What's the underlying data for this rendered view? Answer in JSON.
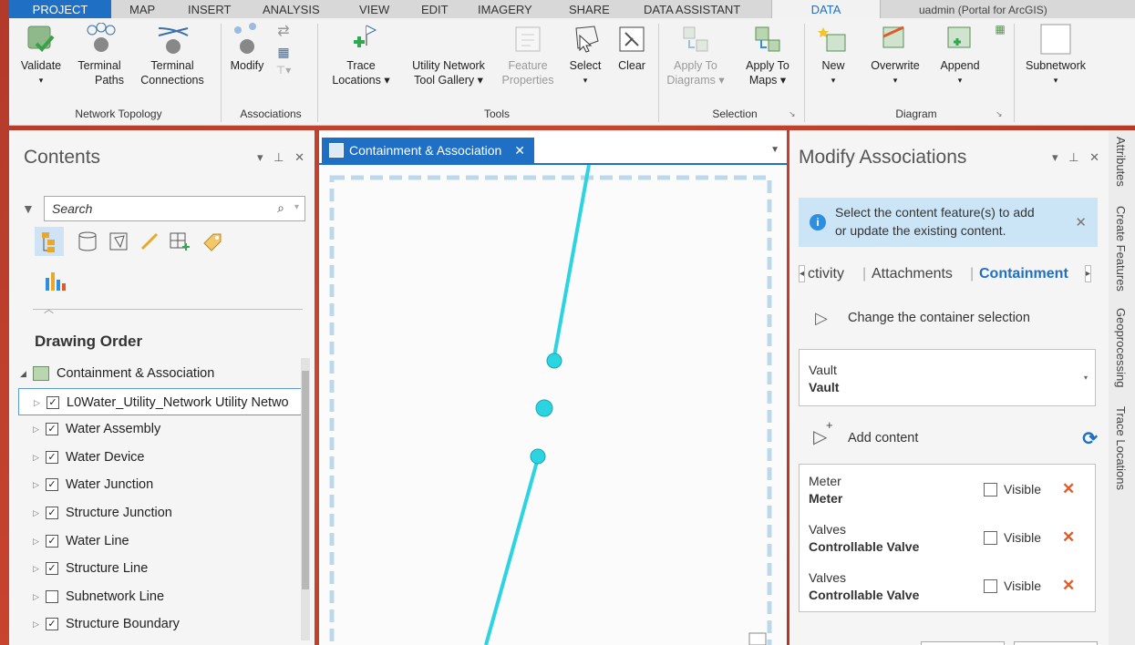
{
  "ribbon": {
    "tabs": [
      "PROJECT",
      "MAP",
      "INSERT",
      "ANALYSIS",
      "VIEW",
      "EDIT",
      "IMAGERY",
      "SHARE",
      "DATA ASSISTANT",
      "DATA",
      "uadmin (Portal for ArcGIS)"
    ],
    "groups": {
      "network_topology": "Network Topology",
      "associations": "Associations",
      "tools": "Tools",
      "selection": "Selection",
      "diagram": "Diagram"
    },
    "buttons": {
      "validate": "Validate",
      "terminal_paths_1": "Terminal",
      "terminal_paths_2": "Paths",
      "terminal_conn_1": "Terminal",
      "terminal_conn_2": "Connections",
      "modify": "Modify",
      "trace_1": "Trace",
      "trace_2": "Locations ▾",
      "gallery_1": "Utility Network",
      "gallery_2": "Tool Gallery ▾",
      "feature_1": "Feature",
      "feature_2": "Properties",
      "select": "Select",
      "clear": "Clear",
      "apply_diagrams_1": "Apply To",
      "apply_diagrams_2": "Diagrams ▾",
      "apply_maps_1": "Apply To",
      "apply_maps_2": "Maps ▾",
      "new": "New",
      "overwrite": "Overwrite",
      "append": "Append",
      "subnetwork": "Subnetwork"
    }
  },
  "contents": {
    "title": "Contents",
    "search_placeholder": "Search",
    "drawing_order": "Drawing Order",
    "root": "Containment & Association",
    "layers": [
      {
        "label": "L0Water_Utility_Network Utility Netwo",
        "checked": "✓"
      },
      {
        "label": "Water Assembly",
        "checked": "✓"
      },
      {
        "label": "Water Device",
        "checked": "✓"
      },
      {
        "label": "Water Junction",
        "checked": "✓"
      },
      {
        "label": "Structure Junction",
        "checked": "✓"
      },
      {
        "label": "Water Line",
        "checked": "✓"
      },
      {
        "label": "Structure Line",
        "checked": "✓"
      },
      {
        "label": "Subnetwork Line",
        "checked": ""
      },
      {
        "label": "Structure Boundary",
        "checked": "✓"
      }
    ]
  },
  "map": {
    "tab_label": "Containment & Association",
    "close": "✕"
  },
  "modify": {
    "title": "Modify Associations",
    "info_line1": "Select the content feature(s) to add",
    "info_line2": "or update the existing content.",
    "subtabs": [
      "ctivity",
      "Attachments",
      "Containment"
    ],
    "change_container": "Change the container selection",
    "container_layer": "Vault",
    "container_value": "Vault",
    "add_content": "Add content",
    "visible_label": "Visible",
    "items": [
      {
        "layer": "Meter",
        "name": "Meter"
      },
      {
        "layer": "Valves",
        "name": "Controllable Valve"
      },
      {
        "layer": "Valves",
        "name": "Controllable Valve"
      }
    ]
  },
  "side_tabs": [
    "Attributes",
    "Create Features",
    "Geoprocessing",
    "Trace Locations"
  ],
  "colors": {
    "accent": "#1f6fc5",
    "network_line": "#2bd4e0",
    "delete": "#e05a2a",
    "background": "#c9452f"
  }
}
